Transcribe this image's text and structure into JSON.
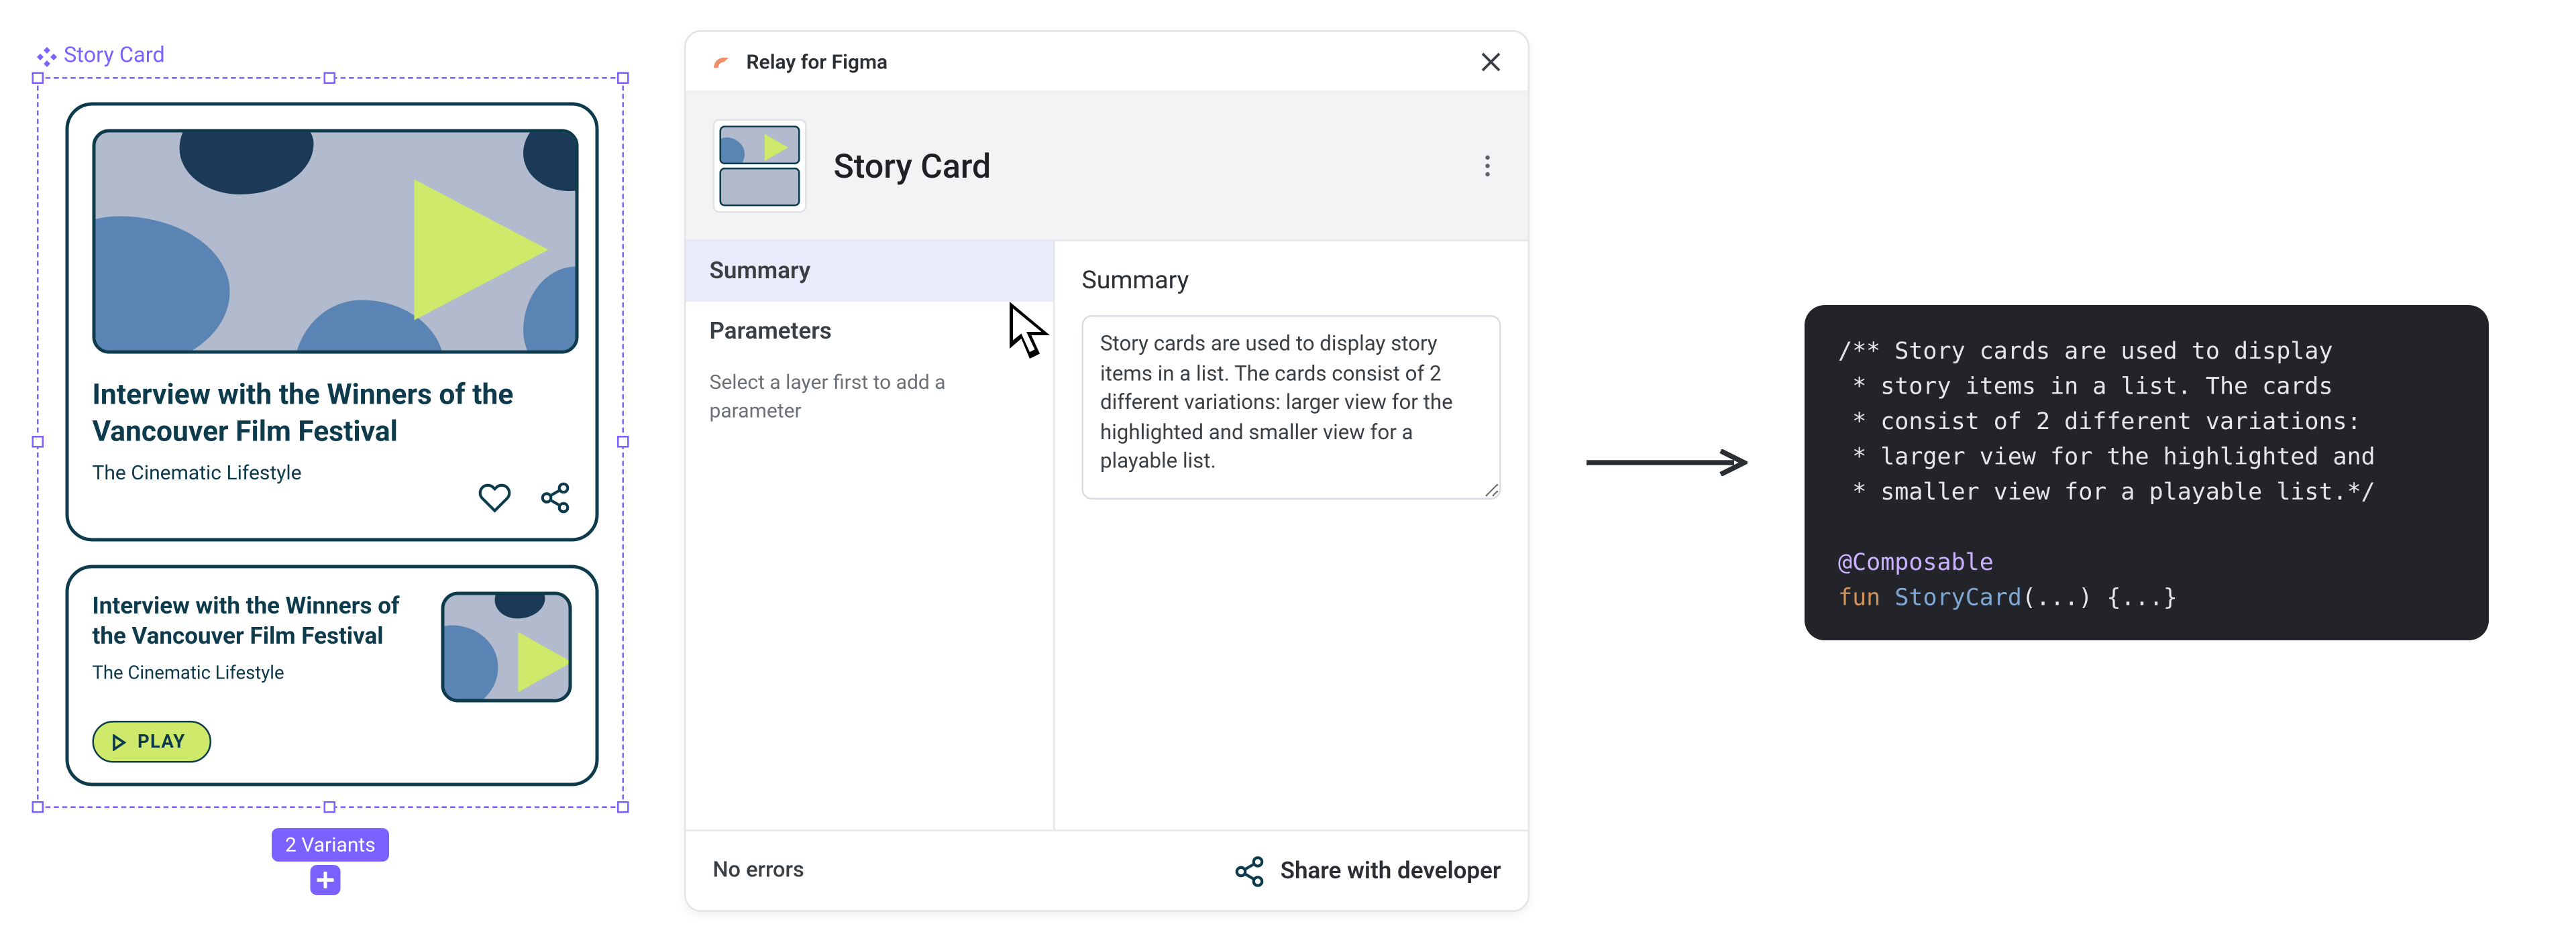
{
  "figma": {
    "component_label": "Story Card",
    "variants_badge": "2 Variants"
  },
  "card_large": {
    "title": "Interview with the Winners of the Vancouver Film Festival",
    "subtitle": "The Cinematic Lifestyle"
  },
  "card_small": {
    "title": "Interview with the Winners of the Vancouver Film Festival",
    "subtitle": "The Cinematic Lifestyle",
    "play_label": "PLAY"
  },
  "relay": {
    "plugin_title": "Relay for Figma",
    "component_name": "Story Card",
    "tabs": {
      "summary": "Summary",
      "parameters": "Parameters",
      "parameters_help": "Select a layer first to add a parameter"
    },
    "content": {
      "heading": "Summary",
      "summary_value": "Story cards are used to display story items in a list. The cards consist of 2 different variations: larger view for the highlighted and smaller view for a playable list."
    },
    "footer": {
      "errors": "No errors",
      "share": "Share with developer"
    }
  },
  "code": {
    "c1": "/** Story cards are used to display",
    "c2": " * story items in a list. The cards",
    "c3": " * consist of 2 different variations:",
    "c4": " * larger view for the highlighted and",
    "c5": " * smaller view for a playable list.*/",
    "ann": "@Composable",
    "kw": "fun",
    "fn": "StoryCard",
    "rest": "(...) {...}"
  },
  "colors": {
    "figma_purple": "#7b61ff",
    "card_stroke": "#0d3b4c",
    "lime": "#cfe96a",
    "code_bg": "#23242a"
  }
}
